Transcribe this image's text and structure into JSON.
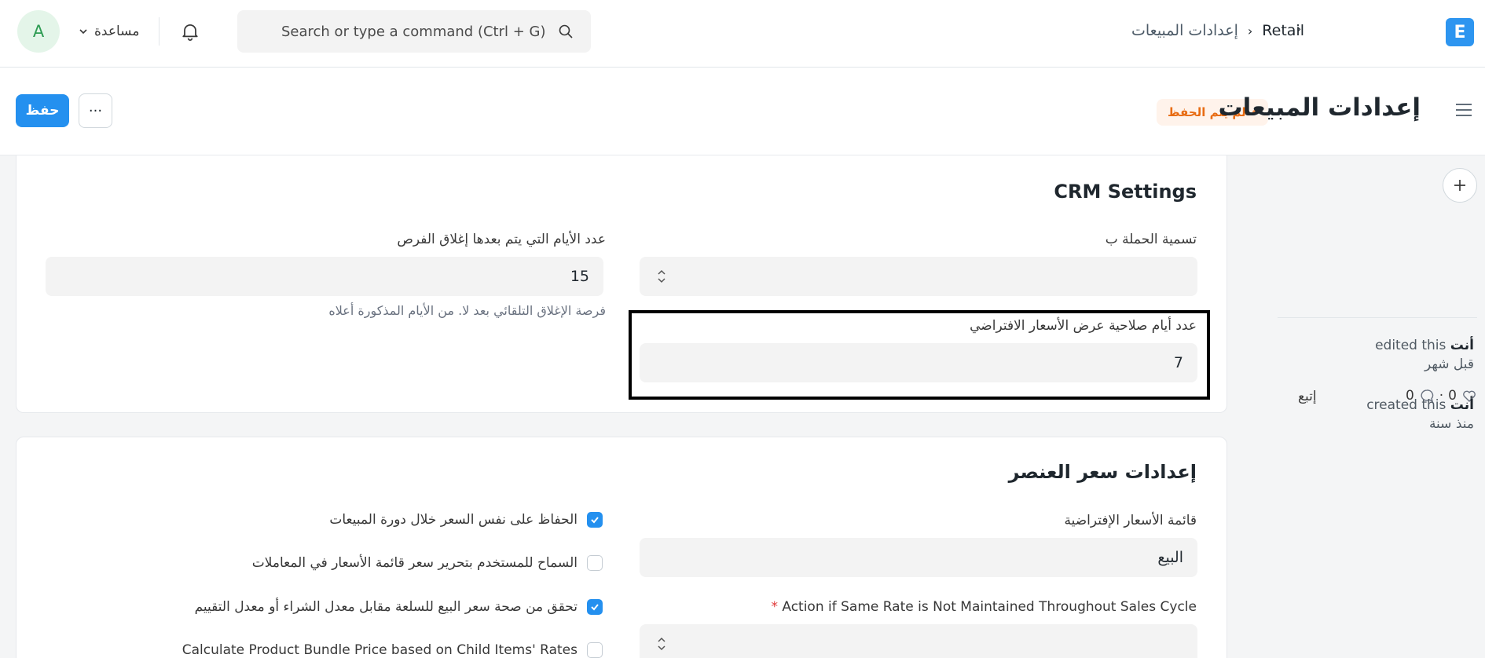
{
  "navbar": {
    "avatar_initial": "A",
    "help_label": "مساعدة",
    "search_placeholder": "Search or type a command (Ctrl + G)",
    "breadcrumb": {
      "root": "Retail",
      "current": "إعدادات المبيعات",
      "separator": "›"
    },
    "app_logo_letter": "E",
    "icons": [
      "bell-icon",
      "search-icon",
      "chevron-down-icon"
    ]
  },
  "page_head": {
    "title": "إعدادات المبيعات",
    "status": "لم يتم الحفظ",
    "save_label": "حفظ",
    "more_label": "···"
  },
  "crm": {
    "title": "CRM Settings",
    "campaign_label": "تسمية الحملة ب",
    "close_days_label": "عدد الأيام التي يتم بعدها إغلاق الفرص",
    "close_days_value": "15",
    "close_days_help": "فرصة الإغلاق التلقائي بعد لا. من الأيام المذكورة أعلاه",
    "quotation_days_label": "عدد أيام صلاحية عرض الأسعار الافتراضي",
    "quotation_days_value": "7"
  },
  "item_price": {
    "title": "إعدادات سعر العنصر",
    "price_list_label": "قائمة الأسعار الإفتراضية",
    "price_list_value": "البيع",
    "action_label": "Action if Same Rate is Not Maintained Throughout Sales Cycle",
    "required_mark": "*",
    "checks": [
      {
        "label": "الحفاظ على نفس السعر خلال دورة المبيعات",
        "checked": true
      },
      {
        "label": "السماح للمستخدم بتحرير سعر قائمة الأسعار في المعاملات",
        "checked": false
      },
      {
        "label": "تحقق من صحة سعر البيع للسلعة مقابل معدل الشراء أو معدل التقييم",
        "checked": true
      },
      {
        "label": "Calculate Product Bundle Price based on Child Items' Rates",
        "checked": false
      }
    ]
  },
  "timeline": {
    "follow_label": "إتبع",
    "likes": "0",
    "comments": "0",
    "dot": "·",
    "activities": [
      {
        "user": "أنت",
        "action": "edited this",
        "when": "قبل شهر"
      },
      {
        "user": "أنت",
        "action": "created this",
        "when": "منذ سنة"
      }
    ]
  },
  "colors": {
    "primary": "#2490ef",
    "status_text": "#e86c13",
    "status_bg": "#fff3eb",
    "avatar_bg": "#e4f5e9"
  }
}
